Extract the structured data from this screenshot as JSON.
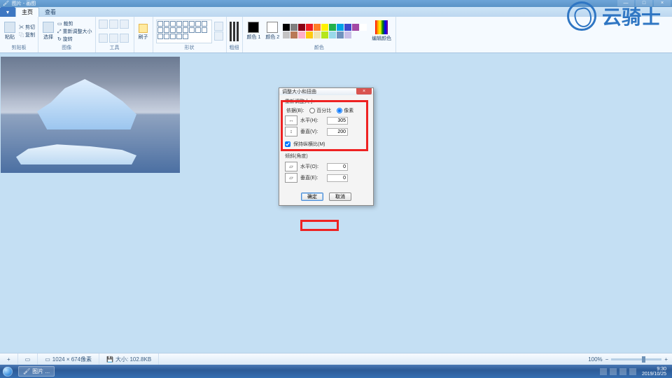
{
  "window": {
    "title": "图片 - 画图",
    "min": "—",
    "max": "□",
    "close": "×"
  },
  "qat": {
    "menu": "▾",
    "tab_home": "主页",
    "tab_view": "查看"
  },
  "ribbon": {
    "clipboard": {
      "label": "剪贴板",
      "paste": "粘贴",
      "cut": "✂ 剪切",
      "copy": "⿻ 复制"
    },
    "image": {
      "label": "图像",
      "select": "选择",
      "crop": "▭ 裁剪",
      "resize": "⤢ 重新调整大小",
      "rotate": "↻ 旋转"
    },
    "tools": {
      "label": "工具",
      "brush": "刷子"
    },
    "shapes": {
      "label": "形状"
    },
    "stroke": {
      "label": "粗细"
    },
    "colors": {
      "label": "颜色",
      "c1": "颜色 1",
      "c2": "颜色 2",
      "edit": "编辑颜色"
    }
  },
  "palette_colors": [
    "#000",
    "#7f7f7f",
    "#880015",
    "#ed1c24",
    "#ff7f27",
    "#fff200",
    "#22b14c",
    "#00a2e8",
    "#3f48cc",
    "#a349a4",
    "#fff",
    "#c3c3c3",
    "#b97a57",
    "#ffaec9",
    "#ffc90e",
    "#efe4b0",
    "#b5e61d",
    "#99d9ea",
    "#7092be",
    "#c8bfe7"
  ],
  "dialog": {
    "title": "调整大小和扭曲",
    "resize_legend": "重新调整大小",
    "by_label": "依据(B):",
    "opt_percent": "百分比",
    "opt_pixel": "像素",
    "h_label": "水平(H):",
    "v_label": "垂直(V):",
    "h_val": "305",
    "v_val": "200",
    "aspect": "保持纵横比(M)",
    "skew_legend": "倾斜(角度)",
    "skew_h": "水平(O):",
    "skew_v": "垂直(E):",
    "skew_hv": "0",
    "skew_vv": "0",
    "ok": "确定",
    "cancel": "取消",
    "close": "×"
  },
  "watermark": {
    "text": "云骑士"
  },
  "status": {
    "pos_ic": "+",
    "sel_ic": "▭",
    "dim": "1024 × 674像素",
    "size": "大小: 102.8KB",
    "zoom": "100%",
    "minus": "−",
    "plus": "+"
  },
  "taskbar": {
    "task": "图片 ...",
    "time": "9:30",
    "date": "2019/10/25"
  }
}
